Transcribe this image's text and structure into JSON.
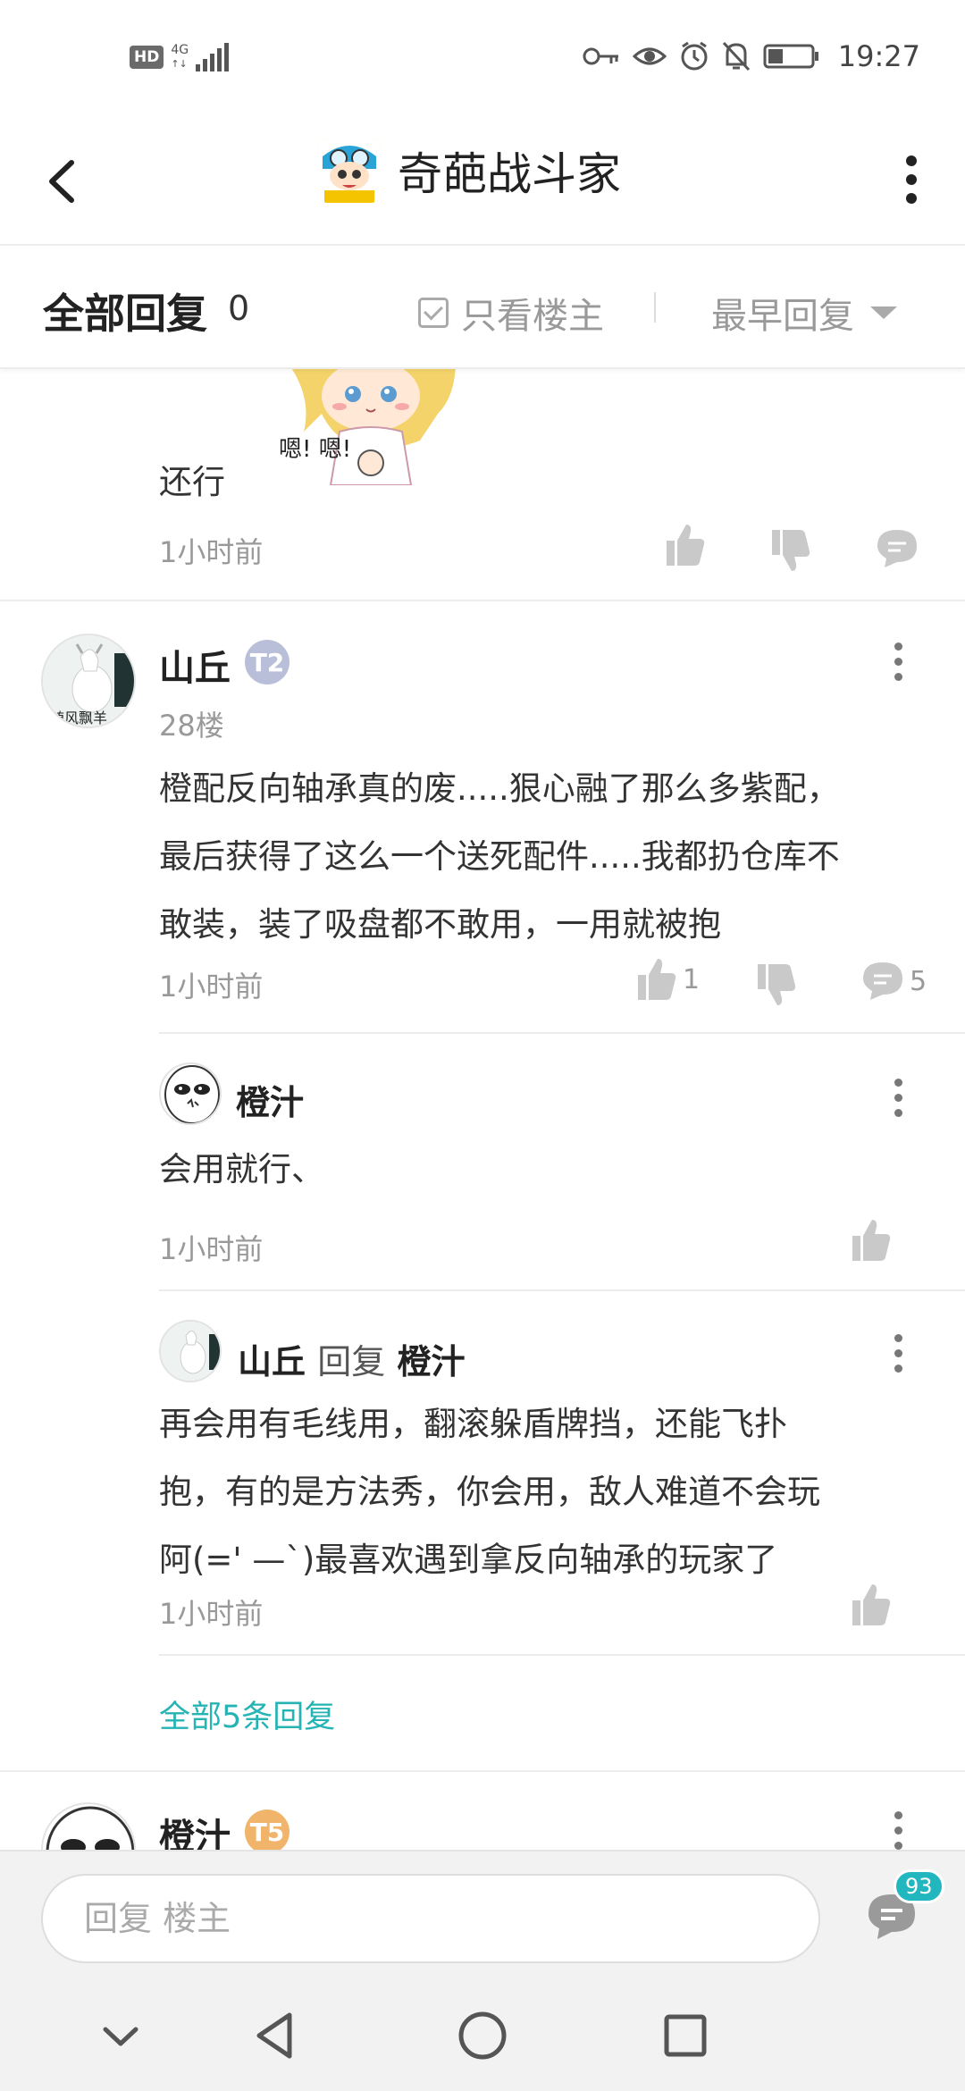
{
  "status_bar": {
    "hd": "HD",
    "network": "4G",
    "network_sub": "↑↓",
    "time": "19:27"
  },
  "header": {
    "title": "奇葩战斗家"
  },
  "filter": {
    "title": "全部回复",
    "count": "0",
    "only_op_label": "只看楼主",
    "sort_label": "最早回复"
  },
  "prev_post": {
    "text": "还行",
    "time": "1小时前",
    "sticker_text": "嗯!  嗯!"
  },
  "post": {
    "user": "山丘",
    "level": "T2",
    "avatar_caption": "随风飘羊",
    "floor": "28楼",
    "lines": [
      "橙配反向轴承真的废.....狠心融了那么多紫配，",
      "最后获得了这么一个送死配件.....我都扔仓库不",
      "敢装，装了吸盘都不敢用，一用就被抱"
    ],
    "time": "1小时前",
    "likes": "1",
    "comments": "5"
  },
  "replies": [
    {
      "user": "橙汁",
      "text": "会用就行、",
      "time": "1小时前"
    },
    {
      "user": "山丘",
      "reply_word": "回复",
      "reply_to": "橙汁",
      "lines": [
        "再会用有毛线用，翻滚躲盾牌挡，还能飞扑",
        "抱，有的是方法秀，你会用，敌人难道不会玩",
        "阿(='  —`)最喜欢遇到拿反向轴承的玩家了"
      ],
      "time": "1小时前"
    }
  ],
  "all_replies_link": "全部5条回复",
  "next_post": {
    "user": "橙汁",
    "level": "T5"
  },
  "input": {
    "placeholder": "回复  楼主",
    "badge": "93"
  },
  "colors": {
    "accent": "#25b3b3",
    "badge": "#22b7bf",
    "level_t2": "#b9bfd9",
    "level_t5": "#f0b46a"
  }
}
